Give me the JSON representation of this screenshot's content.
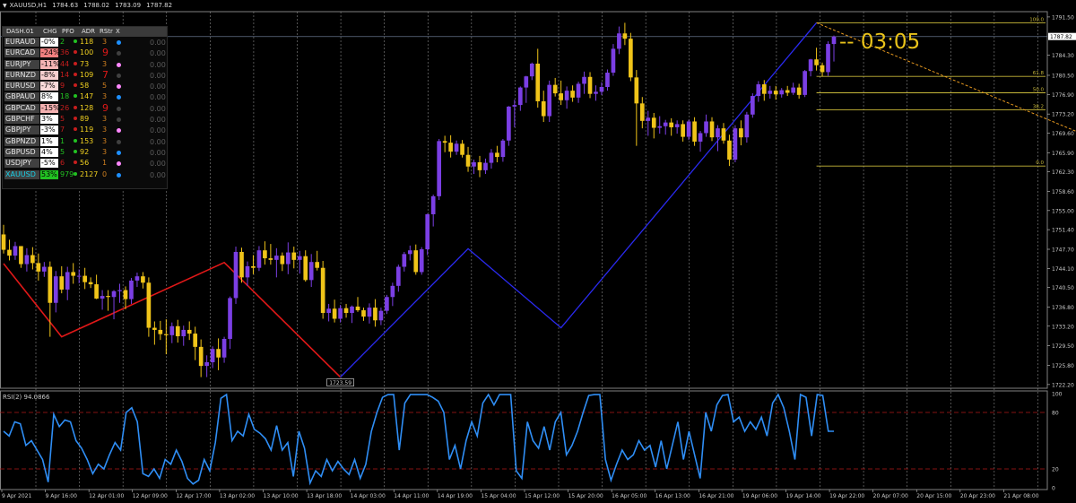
{
  "header": {
    "symbol": "XAUUSD,H1",
    "open": "1784.63",
    "high": "1788.02",
    "low": "1783.09",
    "close": "1787.82"
  },
  "timer": "--  03:05",
  "low_label": "1723.59",
  "rsi_label": "RSI(2) 94.0866",
  "price_axis": [
    "1791.50",
    "1787.82",
    "1784.30",
    "1780.50",
    "1776.90",
    "1773.20",
    "1769.60",
    "1765.90",
    "1762.30",
    "1758.60",
    "1755.00",
    "1751.40",
    "1747.70",
    "1744.10",
    "1740.50",
    "1736.80",
    "1733.20",
    "1729.50",
    "1725.80",
    "1722.20"
  ],
  "rsi_axis": [
    "100",
    "80",
    "20",
    "0"
  ],
  "fib_levels": [
    {
      "label": "100.0",
      "price": 1790.4
    },
    {
      "label": "61.8",
      "price": 1780.3
    },
    {
      "label": "50.0",
      "price": 1777.2
    },
    {
      "label": "38.2",
      "price": 1774.0
    },
    {
      "label": "0.0",
      "price": 1763.4
    }
  ],
  "time_axis": [
    "9 Apr 2021",
    "9 Apr 16:00",
    "12 Apr 01:00",
    "12 Apr 09:00",
    "12 Apr 17:00",
    "13 Apr 02:00",
    "13 Apr 10:00",
    "13 Apr 18:00",
    "14 Apr 03:00",
    "14 Apr 11:00",
    "14 Apr 19:00",
    "15 Apr 04:00",
    "15 Apr 12:00",
    "15 Apr 20:00",
    "16 Apr 05:00",
    "16 Apr 13:00",
    "16 Apr 21:00",
    "19 Apr 06:00",
    "19 Apr 14:00",
    "19 Apr 22:00",
    "20 Apr 07:00",
    "20 Apr 15:00",
    "20 Apr 23:00",
    "21 Apr 08:00"
  ],
  "dashboard": {
    "title": "DASH.01",
    "columns": [
      "CHG",
      "PFO",
      "ADR",
      "RStr",
      "X"
    ],
    "rows": [
      {
        "sym": "EURAUD",
        "chg": "-0%",
        "chg_bg": "#ffffff",
        "pfo": "2",
        "pfo_c": "pos",
        "adr": "118",
        "rs": "3",
        "rs_big": false,
        "dot": "#1e90ff",
        "val": "0.00"
      },
      {
        "sym": "EURCAD",
        "chg": "-24%",
        "chg_bg": "#f08080",
        "pfo": "36",
        "pfo_c": "neg",
        "adr": "100",
        "rs": "9",
        "rs_big": true,
        "dot": "#404040",
        "val": "0.00"
      },
      {
        "sym": "EURJPY",
        "chg": "-11%",
        "chg_bg": "#f4b4b4",
        "pfo": "44",
        "pfo_c": "neg",
        "adr": "73",
        "rs": "3",
        "rs_big": false,
        "dot": "#ff88ff",
        "val": "0.00"
      },
      {
        "sym": "EURNZD",
        "chg": "-8%",
        "chg_bg": "#f8d0d0",
        "pfo": "14",
        "pfo_c": "neg",
        "adr": "109",
        "rs": "7",
        "rs_big": true,
        "dot": "#404040",
        "val": "0.00"
      },
      {
        "sym": "EURUSD",
        "chg": "-7%",
        "chg_bg": "#f8d8d8",
        "pfo": "9",
        "pfo_c": "neg",
        "adr": "58",
        "rs": "5",
        "rs_big": false,
        "dot": "#ff88ff",
        "val": "0.00"
      },
      {
        "sym": "GBPAUD",
        "chg": "8%",
        "chg_bg": "#ffffff",
        "pfo": "18",
        "pfo_c": "pos",
        "adr": "147",
        "rs": "3",
        "rs_big": false,
        "dot": "#1e90ff",
        "val": "0.00"
      },
      {
        "sym": "GBPCAD",
        "chg": "-15%",
        "chg_bg": "#f4b0b0",
        "pfo": "26",
        "pfo_c": "neg",
        "adr": "128",
        "rs": "9",
        "rs_big": true,
        "dot": "#404040",
        "val": "0.00"
      },
      {
        "sym": "GBPCHF",
        "chg": "3%",
        "chg_bg": "#ffffff",
        "pfo": "5",
        "pfo_c": "neg",
        "adr": "89",
        "rs": "3",
        "rs_big": false,
        "dot": "#404040",
        "val": "0.00"
      },
      {
        "sym": "GBPJPY",
        "chg": "-3%",
        "chg_bg": "#ffffff",
        "pfo": "7",
        "pfo_c": "neg",
        "adr": "119",
        "rs": "3",
        "rs_big": false,
        "dot": "#ff88ff",
        "val": "0.00"
      },
      {
        "sym": "GBPNZD",
        "chg": "1%",
        "chg_bg": "#ffffff",
        "pfo": "1",
        "pfo_c": "pos",
        "adr": "153",
        "rs": "3",
        "rs_big": false,
        "dot": "#404040",
        "val": "0.00"
      },
      {
        "sym": "GBPUSD",
        "chg": "4%",
        "chg_bg": "#ffffff",
        "pfo": "5",
        "pfo_c": "pos",
        "adr": "92",
        "rs": "3",
        "rs_big": false,
        "dot": "#1e90ff",
        "val": "0.00"
      },
      {
        "sym": "USDJPY",
        "chg": "-5%",
        "chg_bg": "#ffffff",
        "pfo": "6",
        "pfo_c": "neg",
        "adr": "56",
        "rs": "1",
        "rs_big": false,
        "dot": "#ff88ff",
        "val": "0.00"
      },
      {
        "sym": "XAUUSD",
        "chg": "53%",
        "chg_bg": "#22c222",
        "pfo": "979",
        "pfo_c": "pos",
        "adr": "2127",
        "rs": "0",
        "rs_big": false,
        "dot": "#1e90ff",
        "val": "0.00",
        "highlight": true
      }
    ]
  },
  "colors": {
    "bull": "#7b3fe4",
    "bear": "#f0c419",
    "zigzag_up": "#2a2af0",
    "zigzag_down": "#e01818",
    "rsi_line": "#2f8ef5",
    "fib": "#c8b83a",
    "grid": "#ffffff",
    "rsi_level": "#b01818"
  },
  "candles": [
    [
      1750.5,
      1752.3,
      1746.9,
      1747.6
    ],
    [
      1747.6,
      1749.5,
      1745.6,
      1746.5
    ],
    [
      1746.5,
      1749.1,
      1745.7,
      1748.3
    ],
    [
      1748.3,
      1748.3,
      1744.2,
      1744.9
    ],
    [
      1744.9,
      1747.9,
      1743.5,
      1746.6
    ],
    [
      1746.6,
      1748.1,
      1743.9,
      1745.1
    ],
    [
      1745.1,
      1746.9,
      1741.8,
      1743.5
    ],
    [
      1743.5,
      1745.3,
      1742.5,
      1744.4
    ],
    [
      1744.4,
      1745.4,
      1731.2,
      1737.6
    ],
    [
      1737.6,
      1743.6,
      1735.8,
      1742.6
    ],
    [
      1742.6,
      1744.5,
      1739.4,
      1740.1
    ],
    [
      1740.1,
      1744.4,
      1738.1,
      1743.4
    ],
    [
      1743.4,
      1745.1,
      1741.2,
      1742.7
    ],
    [
      1742.7,
      1743.9,
      1741.3,
      1742.7
    ],
    [
      1742.7,
      1744.2,
      1740.2,
      1741.5
    ],
    [
      1741.5,
      1742.4,
      1740.4,
      1741.1
    ],
    [
      1741.1,
      1742.9,
      1738.3,
      1738.4
    ],
    [
      1738.4,
      1740.0,
      1736.3,
      1738.9
    ],
    [
      1738.9,
      1740.0,
      1736.1,
      1738.7
    ],
    [
      1738.7,
      1740.0,
      1734.5,
      1739.8
    ],
    [
      1739.8,
      1741.2,
      1737.6,
      1740.0
    ],
    [
      1740.0,
      1740.7,
      1736.4,
      1738.3
    ],
    [
      1738.3,
      1742.3,
      1737.4,
      1741.8
    ],
    [
      1741.8,
      1743.3,
      1740.6,
      1742.6
    ],
    [
      1742.6,
      1743.4,
      1740.3,
      1741.4
    ],
    [
      1741.4,
      1742.4,
      1731.2,
      1732.9
    ],
    [
      1732.9,
      1734.1,
      1729.7,
      1732.5
    ],
    [
      1732.5,
      1734.2,
      1730.6,
      1731.7
    ],
    [
      1731.7,
      1734.5,
      1727.9,
      1731.5
    ],
    [
      1731.5,
      1733.9,
      1730.0,
      1733.2
    ],
    [
      1733.2,
      1734.4,
      1730.1,
      1731.3
    ],
    [
      1731.3,
      1733.3,
      1729.5,
      1732.5
    ],
    [
      1732.5,
      1734.1,
      1730.6,
      1731.8
    ],
    [
      1731.8,
      1733.1,
      1726.8,
      1729.3
    ],
    [
      1729.3,
      1730.7,
      1723.6,
      1725.7
    ],
    [
      1725.7,
      1727.7,
      1723.6,
      1726.4
    ],
    [
      1726.4,
      1729.4,
      1725.3,
      1728.9
    ],
    [
      1728.9,
      1730.9,
      1724.9,
      1727.3
    ],
    [
      1727.3,
      1731.2,
      1726.3,
      1730.8
    ],
    [
      1730.8,
      1738.8,
      1728.9,
      1738.5
    ],
    [
      1738.5,
      1748.2,
      1737.4,
      1747.2
    ],
    [
      1747.2,
      1748.0,
      1741.4,
      1742.4
    ],
    [
      1742.4,
      1745.4,
      1740.8,
      1744.5
    ],
    [
      1744.5,
      1746.6,
      1743.0,
      1744.2
    ],
    [
      1744.2,
      1748.3,
      1743.6,
      1747.5
    ],
    [
      1747.5,
      1749.2,
      1744.8,
      1746.0
    ],
    [
      1746.0,
      1748.7,
      1744.8,
      1745.7
    ],
    [
      1745.7,
      1747.9,
      1742.4,
      1746.5
    ],
    [
      1746.5,
      1747.1,
      1743.6,
      1744.9
    ],
    [
      1744.9,
      1749.0,
      1743.0,
      1747.1
    ],
    [
      1747.1,
      1748.2,
      1744.1,
      1745.7
    ],
    [
      1745.7,
      1747.4,
      1743.1,
      1746.4
    ],
    [
      1746.4,
      1747.5,
      1741.6,
      1741.9
    ],
    [
      1741.9,
      1746.8,
      1740.6,
      1745.3
    ],
    [
      1745.3,
      1747.4,
      1743.7,
      1744.2
    ],
    [
      1744.2,
      1745.5,
      1734.6,
      1735.7
    ],
    [
      1735.7,
      1737.4,
      1734.1,
      1736.5
    ],
    [
      1736.5,
      1738.2,
      1733.9,
      1734.6
    ],
    [
      1734.6,
      1737.2,
      1733.9,
      1736.6
    ],
    [
      1736.6,
      1737.4,
      1734.8,
      1735.7
    ],
    [
      1735.7,
      1737.1,
      1733.8,
      1736.9
    ],
    [
      1736.9,
      1738.7,
      1735.9,
      1736.2
    ],
    [
      1736.2,
      1736.7,
      1734.2,
      1735.0
    ],
    [
      1735.0,
      1737.5,
      1733.7,
      1736.7
    ],
    [
      1736.7,
      1738.3,
      1733.1,
      1734.3
    ],
    [
      1734.3,
      1736.7,
      1733.4,
      1736.1
    ],
    [
      1736.1,
      1739.1,
      1735.5,
      1738.7
    ],
    [
      1738.7,
      1741.4,
      1737.0,
      1740.8
    ],
    [
      1740.8,
      1744.8,
      1739.7,
      1744.4
    ],
    [
      1744.4,
      1747.2,
      1743.5,
      1746.8
    ],
    [
      1746.8,
      1748.4,
      1745.6,
      1747.5
    ],
    [
      1747.5,
      1748.6,
      1742.9,
      1743.4
    ],
    [
      1743.4,
      1748.1,
      1742.9,
      1747.7
    ],
    [
      1747.7,
      1754.4,
      1746.6,
      1754.3
    ],
    [
      1754.3,
      1758.0,
      1752.0,
      1757.7
    ],
    [
      1757.7,
      1768.5,
      1757.0,
      1768.1
    ],
    [
      1768.1,
      1769.1,
      1766.0,
      1767.8
    ],
    [
      1767.8,
      1769.2,
      1765.0,
      1766.1
    ],
    [
      1766.1,
      1768.2,
      1765.5,
      1767.6
    ],
    [
      1767.6,
      1768.3,
      1765.0,
      1765.5
    ],
    [
      1765.5,
      1767.0,
      1762.3,
      1763.3
    ],
    [
      1763.3,
      1764.6,
      1761.9,
      1764.1
    ],
    [
      1764.1,
      1765.3,
      1761.3,
      1762.6
    ],
    [
      1762.6,
      1764.8,
      1761.9,
      1764.0
    ],
    [
      1764.0,
      1766.6,
      1762.9,
      1765.9
    ],
    [
      1765.9,
      1767.2,
      1764.1,
      1765.1
    ],
    [
      1765.1,
      1768.5,
      1764.2,
      1768.2
    ],
    [
      1768.2,
      1774.7,
      1767.2,
      1774.6
    ],
    [
      1774.6,
      1775.9,
      1770.7,
      1774.9
    ],
    [
      1774.9,
      1778.4,
      1773.8,
      1778.2
    ],
    [
      1778.2,
      1780.4,
      1775.3,
      1780.3
    ],
    [
      1780.3,
      1782.9,
      1779.6,
      1782.7
    ],
    [
      1782.7,
      1785.5,
      1774.4,
      1775.6
    ],
    [
      1775.6,
      1777.6,
      1771.7,
      1772.8
    ],
    [
      1772.8,
      1779.5,
      1771.7,
      1778.7
    ],
    [
      1778.7,
      1780.0,
      1776.5,
      1777.1
    ],
    [
      1777.1,
      1779.5,
      1774.9,
      1775.8
    ],
    [
      1775.8,
      1778.4,
      1774.2,
      1777.6
    ],
    [
      1777.6,
      1778.6,
      1775.5,
      1776.3
    ],
    [
      1776.3,
      1779.3,
      1775.3,
      1778.9
    ],
    [
      1778.9,
      1781.2,
      1777.0,
      1780.2
    ],
    [
      1780.2,
      1781.1,
      1776.2,
      1777.0
    ],
    [
      1777.0,
      1778.6,
      1775.7,
      1777.4
    ],
    [
      1777.4,
      1779.2,
      1776.8,
      1778.3
    ],
    [
      1778.3,
      1781.6,
      1777.6,
      1781.0
    ],
    [
      1781.0,
      1786.4,
      1780.4,
      1785.5
    ],
    [
      1785.5,
      1789.7,
      1784.5,
      1788.4
    ],
    [
      1788.4,
      1790.4,
      1786.2,
      1787.4
    ],
    [
      1787.4,
      1788.5,
      1779.4,
      1780.1
    ],
    [
      1780.1,
      1781.5,
      1767.2,
      1775.2
    ],
    [
      1775.2,
      1776.4,
      1770.5,
      1771.9
    ],
    [
      1771.9,
      1773.8,
      1769.1,
      1772.5
    ],
    [
      1772.5,
      1773.4,
      1768.6,
      1770.6
    ],
    [
      1770.6,
      1772.8,
      1769.5,
      1770.9
    ],
    [
      1770.9,
      1772.1,
      1769.3,
      1771.6
    ],
    [
      1771.6,
      1772.4,
      1769.1,
      1770.7
    ],
    [
      1770.7,
      1772.0,
      1769.5,
      1771.3
    ],
    [
      1771.3,
      1772.0,
      1768.0,
      1768.9
    ],
    [
      1768.9,
      1772.1,
      1768.3,
      1771.8
    ],
    [
      1771.8,
      1772.6,
      1767.2,
      1768.0
    ],
    [
      1768.0,
      1770.0,
      1766.1,
      1769.6
    ],
    [
      1769.6,
      1773.1,
      1768.9,
      1771.8
    ],
    [
      1771.8,
      1772.6,
      1768.1,
      1768.8
    ],
    [
      1768.8,
      1771.1,
      1766.2,
      1770.5
    ],
    [
      1770.5,
      1771.5,
      1767.6,
      1768.2
    ],
    [
      1768.2,
      1769.3,
      1763.4,
      1764.6
    ],
    [
      1764.6,
      1771.1,
      1764.1,
      1770.5
    ],
    [
      1770.5,
      1772.0,
      1767.3,
      1768.8
    ],
    [
      1768.8,
      1773.6,
      1767.8,
      1773.1
    ],
    [
      1773.1,
      1777.1,
      1772.5,
      1776.6
    ],
    [
      1776.6,
      1779.4,
      1775.5,
      1778.8
    ],
    [
      1778.8,
      1779.6,
      1775.7,
      1777.0
    ],
    [
      1777.0,
      1778.5,
      1776.1,
      1777.6
    ],
    [
      1777.6,
      1778.5,
      1775.9,
      1776.9
    ],
    [
      1776.9,
      1778.1,
      1776.3,
      1777.7
    ],
    [
      1777.7,
      1778.5,
      1776.6,
      1777.2
    ],
    [
      1777.2,
      1779.1,
      1776.8,
      1778.2
    ],
    [
      1778.2,
      1778.9,
      1776.1,
      1776.8
    ],
    [
      1776.8,
      1781.5,
      1776.4,
      1781.3
    ],
    [
      1781.3,
      1783.6,
      1780.3,
      1783.5
    ],
    [
      1783.5,
      1785.7,
      1781.4,
      1782.4
    ],
    [
      1782.4,
      1782.9,
      1780.3,
      1781.1
    ],
    [
      1781.1,
      1786.9,
      1780.4,
      1786.4
    ],
    [
      1786.4,
      1788.0,
      1783.1,
      1787.8
    ]
  ],
  "zigzag_down": [
    [
      0,
      1745.0
    ],
    [
      10,
      1731.2
    ],
    [
      38,
      1745.2
    ],
    [
      58,
      1723.6
    ]
  ],
  "zigzag_up": [
    [
      58,
      1723.6
    ],
    [
      80,
      1747.8
    ],
    [
      96,
      1732.9
    ],
    [
      140,
      1790.4
    ]
  ],
  "fib_swing": [
    [
      140,
      1790.4
    ],
    [
      199,
      1763.4
    ],
    [
      234,
      1788.4
    ]
  ],
  "rsi": [
    60,
    55,
    70,
    68,
    45,
    50,
    40,
    30,
    6,
    78,
    65,
    72,
    70,
    50,
    42,
    30,
    15,
    25,
    20,
    35,
    48,
    40,
    80,
    85,
    70,
    15,
    12,
    20,
    10,
    30,
    25,
    40,
    28,
    10,
    4,
    8,
    30,
    18,
    48,
    95,
    99,
    50,
    60,
    55,
    78,
    62,
    58,
    52,
    40,
    66,
    40,
    48,
    12,
    60,
    42,
    5,
    18,
    12,
    30,
    18,
    28,
    20,
    14,
    30,
    10,
    25,
    60,
    80,
    96,
    99,
    99,
    40,
    90,
    99,
    99,
    99,
    99,
    96,
    92,
    80,
    30,
    45,
    20,
    50,
    70,
    55,
    90,
    99,
    88,
    99,
    99,
    99,
    18,
    10,
    70,
    50,
    42,
    65,
    40,
    70,
    80,
    35,
    45,
    60,
    80,
    98,
    99,
    99,
    30,
    8,
    25,
    40,
    30,
    35,
    50,
    40,
    45,
    22,
    50,
    20,
    45,
    70,
    30,
    60,
    35,
    10,
    80,
    60,
    88,
    98,
    99,
    70,
    75,
    60,
    70,
    62,
    75,
    55,
    90,
    99,
    85,
    60,
    30,
    99,
    96,
    55,
    99,
    98,
    60,
    60
  ],
  "chart_data": {
    "type": "table",
    "title": "XAUUSD,H1",
    "series": [
      {
        "name": "XAUUSD,H1",
        "values": []
      }
    ]
  }
}
